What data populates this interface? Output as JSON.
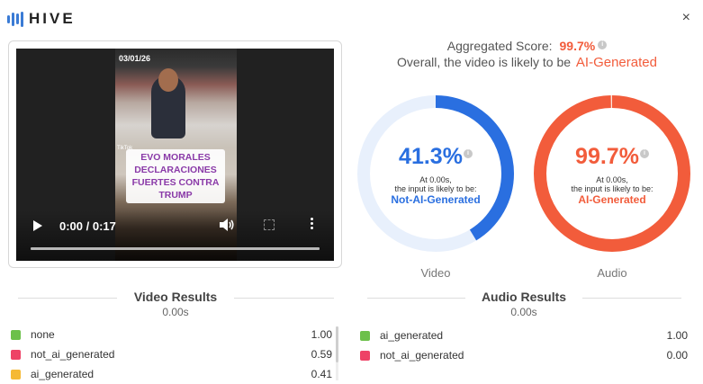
{
  "header": {
    "logo_text": "HIVE",
    "close_label": "×"
  },
  "video": {
    "date_overlay": "03/01/26",
    "watermark": "TikTok",
    "caption_lines": [
      "EVO MORALES",
      "DECLARACIONES",
      "FUERTES CONTRA",
      "TRUMP"
    ],
    "time_display": "0:00 / 0:17",
    "progress": 0.0
  },
  "aggregate": {
    "label": "Aggregated Score:",
    "score": "99.7%",
    "summary_prefix": "Overall, the video is likely to be",
    "verdict": "AI-Generated"
  },
  "gauges": [
    {
      "name": "Video",
      "percent_text": "41.3%",
      "percent_value": 0.413,
      "sub1": "At 0.00s,",
      "sub2": "the input is likely to be:",
      "verdict": "Not-AI-Generated",
      "color": "#2a6fe0",
      "track_color": "#e8f0fc"
    },
    {
      "name": "Audio",
      "percent_text": "99.7%",
      "percent_value": 0.997,
      "sub1": "At 0.00s,",
      "sub2": "the input is likely to be:",
      "verdict": "AI-Generated",
      "color": "#f25c3b",
      "track_color": "#fde6df"
    }
  ],
  "video_results": {
    "title": "Video Results",
    "time": "0.00s",
    "rows": [
      {
        "label": "none",
        "value": "1.00",
        "color": "#6cc04a"
      },
      {
        "label": "not_ai_generated",
        "value": "0.59",
        "color": "#ee4266"
      },
      {
        "label": "ai_generated",
        "value": "0.41",
        "color": "#f5b935"
      }
    ]
  },
  "audio_results": {
    "title": "Audio Results",
    "time": "0.00s",
    "rows": [
      {
        "label": "ai_generated",
        "value": "1.00",
        "color": "#6cc04a"
      },
      {
        "label": "not_ai_generated",
        "value": "0.00",
        "color": "#ee4266"
      }
    ]
  },
  "colors": {
    "brand": "#3a7bd5",
    "ai_accent": "#f25c3b",
    "not_ai_accent": "#2a6fe0"
  }
}
